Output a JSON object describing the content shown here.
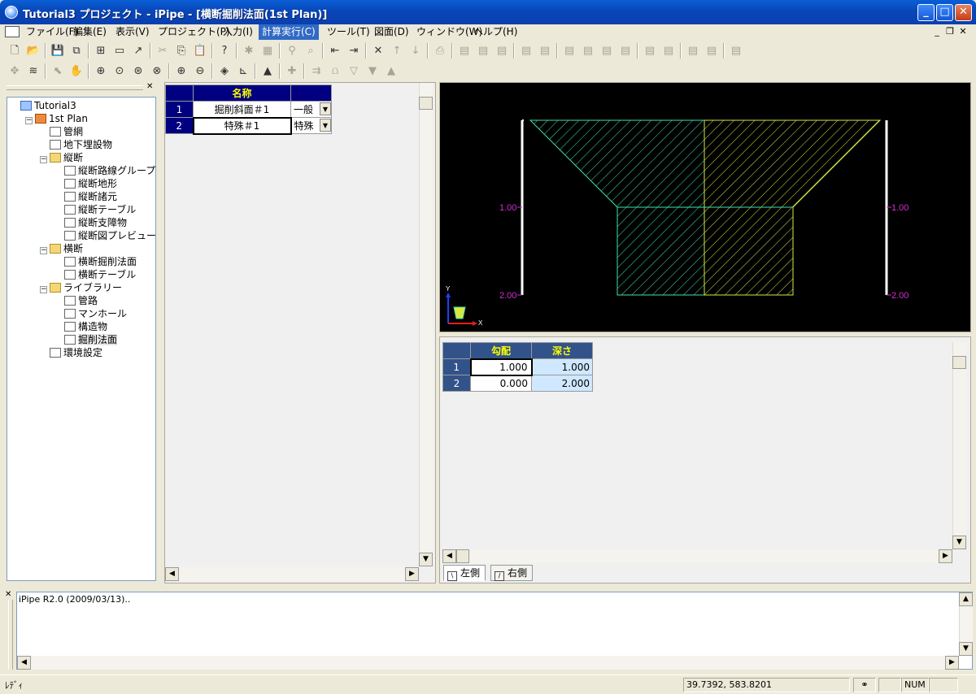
{
  "window": {
    "title": "Tutorial3 プロジェクト - iPipe - [横断掘削法面(1st Plan)]"
  },
  "menu": {
    "items": [
      "ファイル(F)",
      "編集(E)",
      "表示(V)",
      "プロジェクト(P)",
      "入力(I)",
      "計算実行(C)",
      "ツール(T)",
      "図面(D)",
      "ウィンドウ(W)",
      "ヘルプ(H)"
    ],
    "active_index": 5
  },
  "toolbar1": {
    "icons": [
      "new-icon",
      "open-icon",
      "save-icon",
      "save-all-icon",
      "tree-view-icon",
      "window-icon",
      "arrow-icon",
      "cut-icon",
      "copy-icon",
      "paste-icon",
      "help-icon",
      "settings-icon",
      "grid-icon",
      "binoculars-icon",
      "find-icon",
      "insert-before-icon",
      "insert-after-icon",
      "delete-icon",
      "up-icon",
      "down-icon",
      "print-icon",
      "sheet1-icon",
      "sheet2-icon",
      "sheet3-icon",
      "sheet4-icon",
      "sheet5-icon",
      "sheet6-icon",
      "sheet7-icon",
      "sheet8-icon",
      "sheet9-icon",
      "sheet10-icon",
      "sheet11-icon",
      "sheet12-icon",
      "sheet13-icon",
      "sheet14-icon"
    ]
  },
  "toolbar2": {
    "icons": [
      "move-icon",
      "layers-icon",
      "select-icon",
      "pan-icon",
      "zoom-window-icon",
      "zoom-extents-icon",
      "zoom-realtime-icon",
      "zoom-previous-icon",
      "zoom-in-icon",
      "zoom-out-icon",
      "fill-icon",
      "axis-icon",
      "redraw-icon",
      "cross-icon",
      "pipe-icon",
      "profile-icon",
      "trench-icon",
      "trench2-icon",
      "cone-icon"
    ]
  },
  "tree": {
    "items": [
      {
        "label": "Tutorial3",
        "level": 0,
        "icon": "project-icon"
      },
      {
        "label": "1st Plan",
        "level": 1,
        "icon": "plan-icon",
        "expander": "−"
      },
      {
        "label": "管網",
        "level": 2,
        "icon": "network-icon"
      },
      {
        "label": "地下埋設物",
        "level": 2,
        "icon": "buried-objects-icon"
      },
      {
        "label": "縦断",
        "level": 2,
        "icon": "folder-icon",
        "expander": "−"
      },
      {
        "label": "縦断路線グループ",
        "level": 3,
        "icon": "route-group-icon"
      },
      {
        "label": "縦断地形",
        "level": 3,
        "icon": "terrain-icon"
      },
      {
        "label": "縦断諸元",
        "level": 3,
        "icon": "specs-icon"
      },
      {
        "label": "縦断テーブル",
        "level": 3,
        "icon": "table-icon"
      },
      {
        "label": "縦断支障物",
        "level": 3,
        "icon": "obstacle-icon"
      },
      {
        "label": "縦断図プレビュー",
        "level": 3,
        "icon": "preview-icon"
      },
      {
        "label": "横断",
        "level": 2,
        "icon": "folder-icon",
        "expander": "−"
      },
      {
        "label": "横断掘削法面",
        "level": 3,
        "icon": "slope-icon"
      },
      {
        "label": "横断テーブル",
        "level": 3,
        "icon": "table-icon"
      },
      {
        "label": "ライブラリー",
        "level": 2,
        "icon": "folder-icon",
        "expander": "−"
      },
      {
        "label": "管路",
        "level": 3,
        "icon": "pipe-icon"
      },
      {
        "label": "マンホール",
        "level": 3,
        "icon": "manhole-icon"
      },
      {
        "label": "構造物",
        "level": 3,
        "icon": "structure-icon"
      },
      {
        "label": "掘削法面",
        "level": 3,
        "icon": "excavation-icon",
        "selected": true
      },
      {
        "label": "環境設定",
        "level": 2,
        "icon": "environment-icon"
      }
    ]
  },
  "name_grid": {
    "header": "名称",
    "rows": [
      {
        "num": "1",
        "name": "掘削斜面＃1",
        "type": "一般"
      },
      {
        "num": "2",
        "name": "特殊＃1",
        "type": "特殊"
      }
    ]
  },
  "canvas": {
    "left_labels": [
      "1.00",
      "2.00"
    ],
    "right_labels": [
      "1.00",
      "2.00"
    ],
    "axis_y": "Y",
    "axis_x": "X",
    "colors": {
      "cyan": "#40e0b0",
      "yellow": "#d8e840",
      "label": "#d030d0"
    }
  },
  "slope_grid": {
    "headers": [
      "勾配",
      "深さ"
    ],
    "rows": [
      {
        "num": "1",
        "slope": "1.000",
        "depth": "1.000"
      },
      {
        "num": "2",
        "slope": "0.000",
        "depth": "2.000"
      }
    ]
  },
  "tabs": [
    "左側",
    "右側"
  ],
  "output": {
    "text": "iPipe R2.0 (2009/03/13).."
  },
  "status": {
    "ready": "ﾚﾃﾞｨ",
    "coords": "39.7392, 583.8201",
    "num": "NUM"
  }
}
